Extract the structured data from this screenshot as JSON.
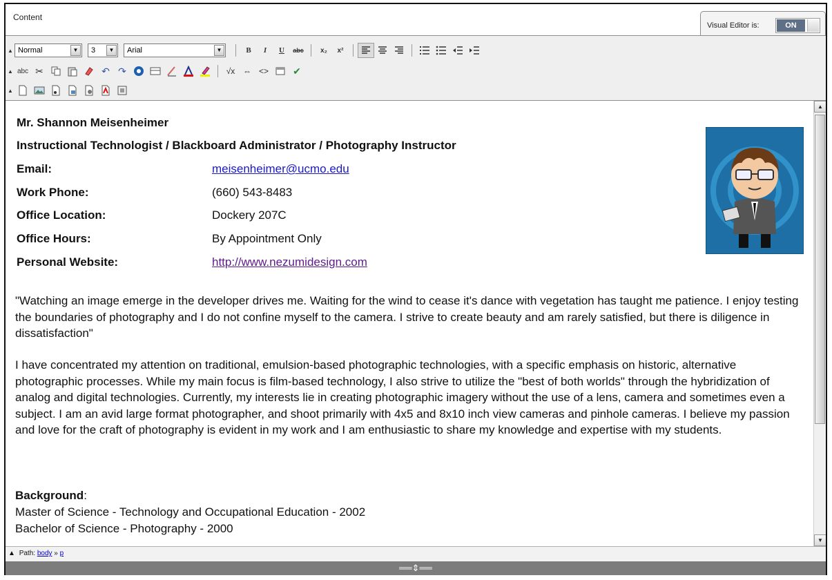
{
  "header": {
    "title": "Content",
    "visual_editor_label": "Visual Editor is:",
    "visual_editor_state": "ON"
  },
  "toolbar": {
    "format_select": "Normal",
    "size_select": "3",
    "font_select": "Arial",
    "buttons_row1": [
      "bold-icon",
      "italic-icon",
      "underline-icon",
      "strikethrough-icon",
      "subscript-icon",
      "superscript-icon",
      "align-left-icon",
      "align-center-icon",
      "align-right-icon",
      "ordered-list-icon",
      "unordered-list-icon",
      "outdent-icon",
      "indent-icon"
    ],
    "row1_labels": {
      "bold": "B",
      "italic": "I",
      "underline": "U",
      "strike": "abc",
      "sub": "x₂",
      "sup": "x²"
    },
    "buttons_row2": [
      "spellcheck-icon",
      "cut-icon",
      "copy-icon",
      "paste-icon",
      "clear-format-icon",
      "undo-icon",
      "redo-icon",
      "link-icon",
      "table-icon",
      "line-icon",
      "text-color-icon",
      "highlight-color-icon",
      "equation-icon",
      "embed-icon",
      "source-icon",
      "preview-icon",
      "check-icon"
    ],
    "row2_labels": {
      "abc": "abc",
      "math": "√x",
      "code": "<>"
    },
    "buttons_row3": [
      "insert-file-icon",
      "insert-image-icon",
      "insert-audio-icon",
      "insert-video-icon",
      "insert-flash-icon",
      "insert-pdf-icon",
      "insert-mashup-icon"
    ]
  },
  "profile": {
    "name": "Mr. Shannon Meisenheimer",
    "title": "Instructional Technologist / Blackboard Administrator / Photography Instructor",
    "rows": [
      {
        "label": "Email:",
        "value": "meisenheimer@ucmo.edu"
      },
      {
        "label": "Work Phone:",
        "value": "(660) 543-8483"
      },
      {
        "label": "Office Location:",
        "value": "Dockery 207C"
      },
      {
        "label": "Office Hours:",
        "value": "By Appointment Only"
      },
      {
        "label": "Personal Website:",
        "value": "http://www.nezumidesign.com"
      }
    ],
    "quote": "\"Watching an image emerge in the developer drives me.   Waiting for the wind to cease it's dance with vegetation has taught me patience.   I enjoy testing the boundaries of photography and I do not confine myself to the camera.   I strive to create beauty and am rarely satisfied, but there is diligence in dissatisfaction\"",
    "bio": "I have concentrated my attention on traditional, emulsion-based photographic technologies, with a specific emphasis on historic, alternative photographic processes.   While my main focus is film-based technology, I also strive to utilize the \"best of both worlds\" through the hybridization of analog and digital technologies.   Currently, my interests lie in creating photographic imagery without the use of a lens, camera and sometimes even a subject.   I am an avid large format photographer, and shoot primarily with 4x5 and 8x10 inch view cameras and pinhole cameras.   I believe my passion and love for the craft of photography is evident in my work and I am enthusiastic to share my knowledge and expertise with my students.",
    "background_label": "Background",
    "background_colon": ":",
    "degrees": [
      "Master of Science - Technology and Occupational Education - 2002",
      "Bachelor of Science - Photography - 2000"
    ]
  },
  "pathbar": {
    "label": "Path:",
    "crumb1": "body",
    "arrow": "»",
    "crumb2": "p"
  },
  "colors": {
    "toggle_on": "#5e6f86",
    "link": "#1a1ac4",
    "visited_link": "#5d1a8f",
    "resize_bar": "#7c7c7c"
  }
}
